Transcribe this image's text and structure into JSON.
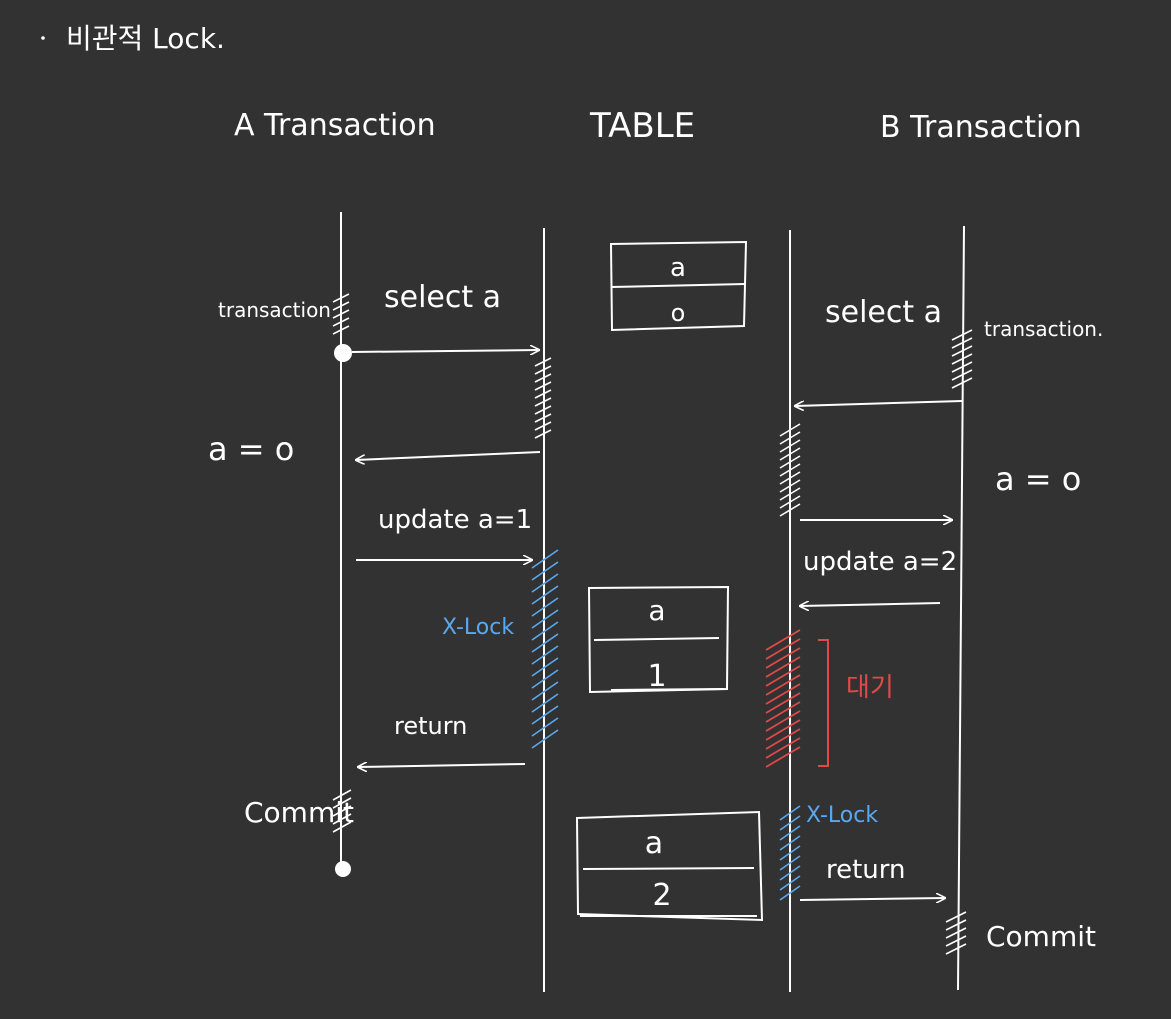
{
  "heading": "비관적 Lock.",
  "columns": {
    "a_transaction": "A Transaction",
    "table": "TABLE",
    "b_transaction": "B Transaction"
  },
  "a_side": {
    "transaction_label": "transaction",
    "select_label": "select a",
    "result_label": "a = o",
    "update_label": "update a=1",
    "xlock_label": "X-Lock",
    "return_label": "return",
    "commit_label": "Commit"
  },
  "b_side": {
    "select_label": "select a",
    "transaction_label": "transaction.",
    "result_label": "a = o",
    "update_label": "update a=2",
    "wait_label": "대기",
    "xlock_label": "X-Lock",
    "return_label": "return",
    "commit_label": "Commit"
  },
  "tables": [
    {
      "column": "a",
      "value": "o"
    },
    {
      "column": "a",
      "value": "1"
    },
    {
      "column": "a",
      "value": "2"
    }
  ],
  "colors": {
    "background": "#323232",
    "ink": "#ffffff",
    "xlock": "#5aa8f0",
    "wait": "#e24848"
  }
}
